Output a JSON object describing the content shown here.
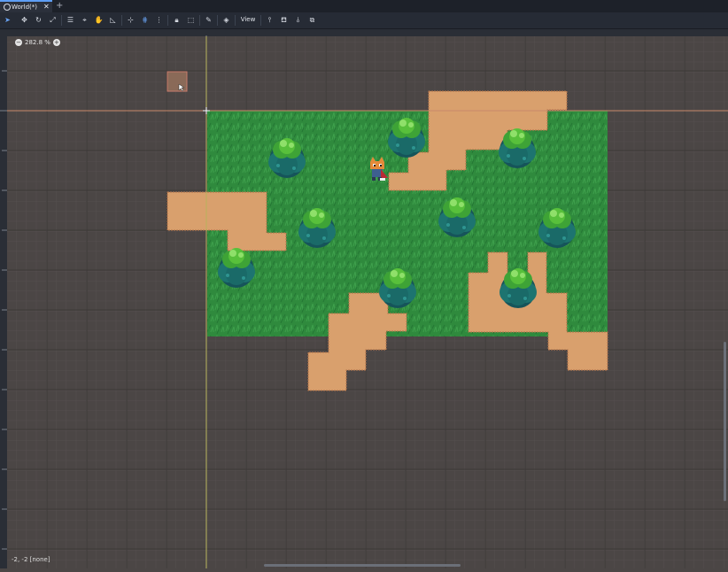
{
  "tab": {
    "label": "World(*)",
    "close": "✕",
    "add": "+"
  },
  "toolbar": {
    "view_label": "View"
  },
  "viewport": {
    "zoom_label": "282.8 %",
    "zoom_out": "−",
    "zoom_in": "+",
    "status": "-2, -2 [none]"
  },
  "colors": {
    "grass": "#2f8a3d",
    "dirt": "#d9a06d",
    "bush_light": "#58c03b",
    "bush_dark": "#1b6e6a",
    "accent": "#5e9ef5"
  },
  "icons": [
    "select-icon",
    "move-icon",
    "rotate-icon",
    "scale-icon",
    "list-icon",
    "pan-icon",
    "hand-icon",
    "ruler-icon",
    "snap-icon",
    "grid-snap-icon",
    "more-icon",
    "lock-icon",
    "group-icon",
    "bone-icon",
    "canvas-icon",
    "pivot-icon",
    "paint-icon",
    "pin-icon",
    "copy-icon"
  ]
}
